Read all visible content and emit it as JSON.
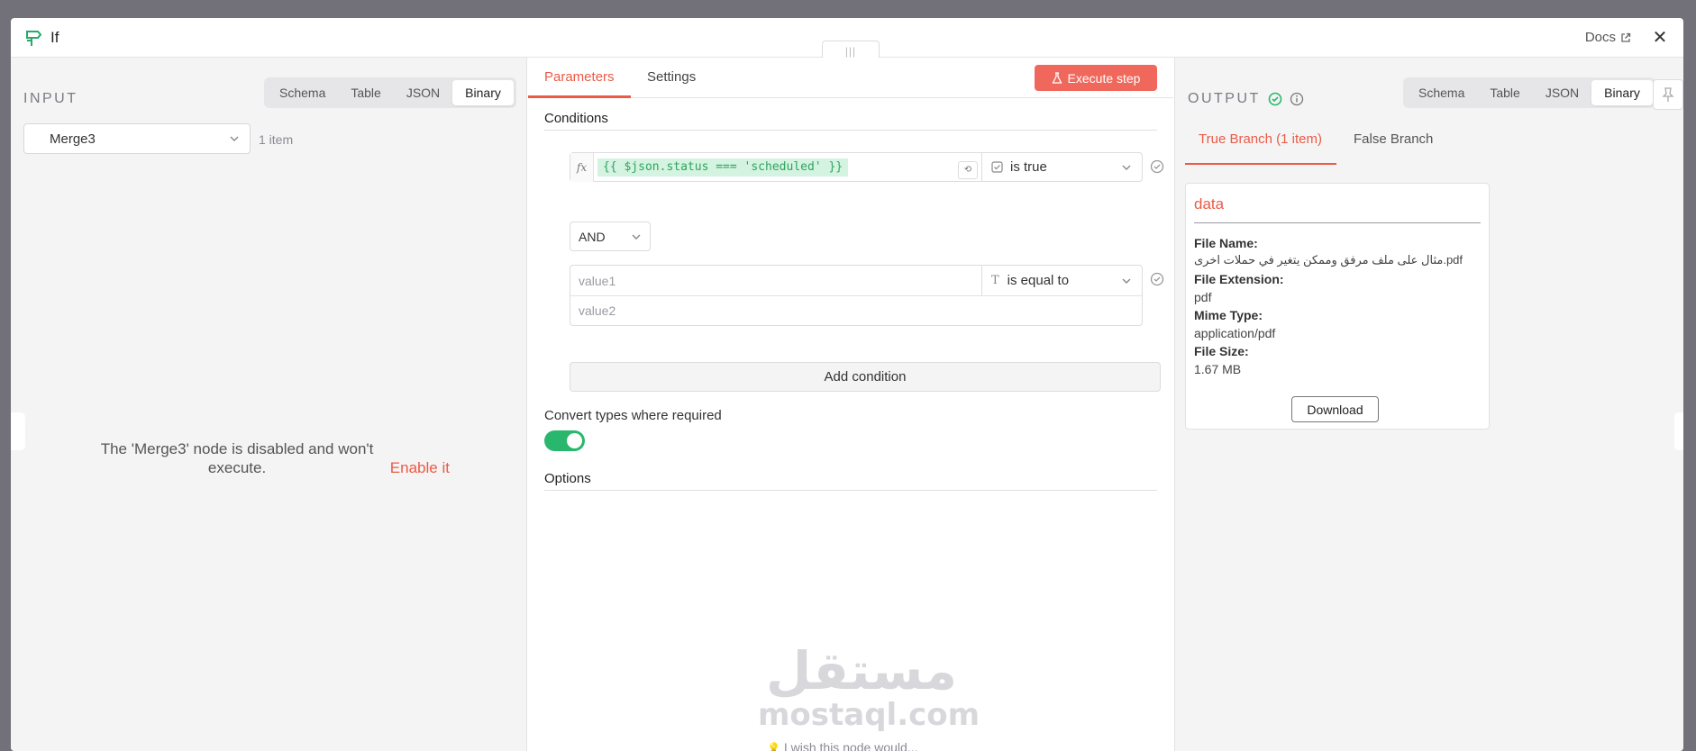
{
  "header": {
    "title": "If",
    "docs_label": "Docs",
    "close_symbol": "✕"
  },
  "input": {
    "label": "INPUT",
    "view_tabs": [
      "Schema",
      "Table",
      "JSON",
      "Binary"
    ],
    "active_view": "Binary",
    "node_select": "Merge3",
    "item_count": "1 item",
    "disabled_message": "The 'Merge3' node is disabled and won't execute.",
    "enable_link": "Enable it"
  },
  "params": {
    "tabs": [
      "Parameters",
      "Settings"
    ],
    "active_tab": "Parameters",
    "execute_label": "Execute step",
    "conditions_title": "Conditions",
    "condition1": {
      "fx": "fx",
      "expression": "{{ $json.status === 'scheduled' }}",
      "operator": "is true"
    },
    "combinator": "AND",
    "condition2": {
      "value1_placeholder": "value1",
      "value2_placeholder": "value2",
      "operator": "is equal to"
    },
    "add_condition_label": "Add condition",
    "convert_label": "Convert types where required",
    "convert_enabled": true,
    "options_title": "Options",
    "wish_text": "I wish this node would..."
  },
  "watermark": {
    "arabic": "مستقل",
    "latin": "mostaql.com"
  },
  "output": {
    "label": "OUTPUT",
    "view_tabs": [
      "Schema",
      "Table",
      "JSON",
      "Binary"
    ],
    "active_view": "Binary",
    "branches": [
      "True Branch (1 item)",
      "False Branch"
    ],
    "active_branch": "True Branch (1 item)",
    "card": {
      "title": "data",
      "file_name_label": "File Name:",
      "file_name": "مثال على ملف مرفق وممكن يتغير في حملات اخرى.pdf",
      "file_ext_label": "File Extension:",
      "file_ext": "pdf",
      "mime_label": "Mime Type:",
      "mime": "application/pdf",
      "size_label": "File Size:",
      "size": "1.67 MB",
      "download_label": "Download"
    }
  },
  "colors": {
    "accent": "#ea5b46",
    "success": "#29b76d",
    "expression_bg": "#d4f3e0"
  }
}
